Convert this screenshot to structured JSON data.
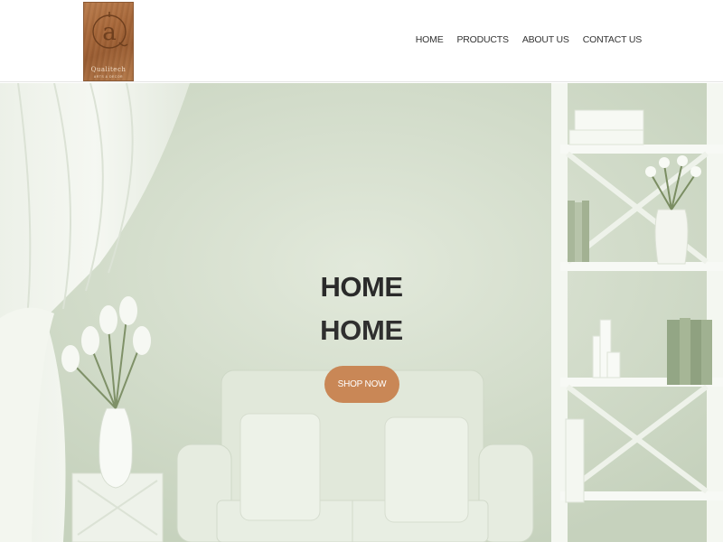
{
  "header": {
    "logo": {
      "icon": "letter-a-monogram-icon",
      "name": "Qualitech",
      "tagline": "ARTS & DECOR",
      "color": "#a8683a"
    },
    "nav": [
      {
        "label": "HOME"
      },
      {
        "label": "PRODUCTS"
      },
      {
        "label": "ABOUT US"
      },
      {
        "label": "CONTACT US"
      }
    ]
  },
  "hero": {
    "title": "HOME",
    "subtitle": "HOME",
    "cta_label": "SHOP NOW",
    "cta_color": "#c98756",
    "background_color": "#d2dcc9"
  }
}
